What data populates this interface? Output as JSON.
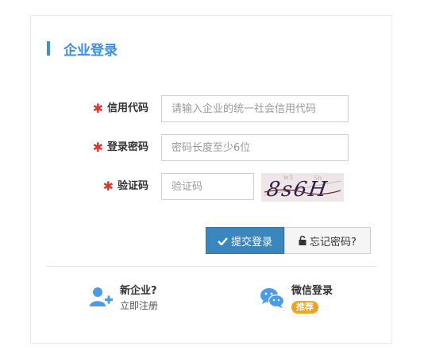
{
  "panel": {
    "title": "企业登录",
    "accent_color": "#3a8ee6"
  },
  "form": {
    "credit_code": {
      "label": "信用代码",
      "placeholder": "请输入企业的统一社会信用代码",
      "value": ""
    },
    "password": {
      "label": "登录密码",
      "placeholder": "密码长度至少6位",
      "value": ""
    },
    "captcha": {
      "label": "验证码",
      "placeholder": "验证码",
      "value": "",
      "image_text": "8s6H"
    },
    "required_mark": "✱"
  },
  "actions": {
    "submit_label": "提交登录",
    "submit_icon": "check-icon",
    "forgot_label": "忘记密码?",
    "forgot_icon": "lock-icon"
  },
  "bottom": {
    "register": {
      "title": "新企业?",
      "subtitle": "立即注册",
      "icon": "add-user-icon"
    },
    "wechat": {
      "title": "微信登录",
      "badge": "推荐",
      "icon": "wechat-icon"
    }
  },
  "colors": {
    "primary": "#3a87c0",
    "required": "#d9372b",
    "badge": "#f0a21a",
    "icon_blue": "#4a9be8"
  }
}
